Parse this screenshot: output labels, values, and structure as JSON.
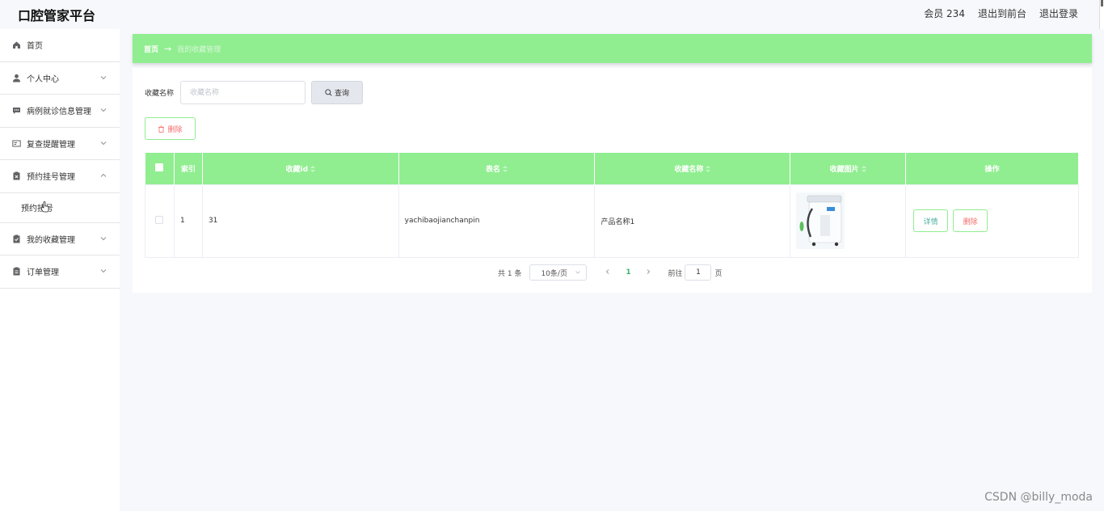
{
  "app": {
    "title": "口腔管家平台"
  },
  "header": {
    "user_label": "会员 234",
    "back_to_front": "退出到前台",
    "logout": "退出登录"
  },
  "sidebar": {
    "items": [
      {
        "label": "首页",
        "icon": "home-icon"
      },
      {
        "label": "个人中心",
        "icon": "user-icon"
      },
      {
        "label": "病例就诊信息管理",
        "icon": "chat-icon"
      },
      {
        "label": "复查提醒管理",
        "icon": "card-icon"
      },
      {
        "label": "预约挂号管理",
        "icon": "clipboard-x-icon"
      },
      {
        "label": "我的收藏管理",
        "icon": "clipboard-check-icon"
      },
      {
        "label": "订单管理",
        "icon": "clipboard-icon"
      }
    ],
    "submenu": {
      "label": "预约挂号"
    }
  },
  "breadcrumb": {
    "home": "首页",
    "separator": "→",
    "current": "我的收藏管理"
  },
  "search": {
    "label": "收藏名称",
    "placeholder": "收藏名称",
    "button_label": "查询"
  },
  "toolbar": {
    "delete_label": "删除"
  },
  "table": {
    "headers": {
      "index": "索引",
      "fav_id": "收藏id",
      "table_name": "表名",
      "fav_name": "收藏名称",
      "fav_image": "收藏图片",
      "actions": "操作"
    },
    "rows": [
      {
        "index": "1",
        "fav_id": "31",
        "table_name": "yachibaojianchanpin",
        "fav_name": "产品名称1",
        "detail_label": "详情",
        "delete_label": "删除"
      }
    ]
  },
  "pagination": {
    "total": "共 1 条",
    "page_size": "10条/页",
    "current_page": "1",
    "goto_label": "前往",
    "goto_value": "1",
    "goto_unit": "页"
  },
  "watermark": "CSDN @billy_moda",
  "colors": {
    "accent": "#90ee90",
    "danger": "#f56c6c",
    "page_bg": "#f7f8fc"
  }
}
